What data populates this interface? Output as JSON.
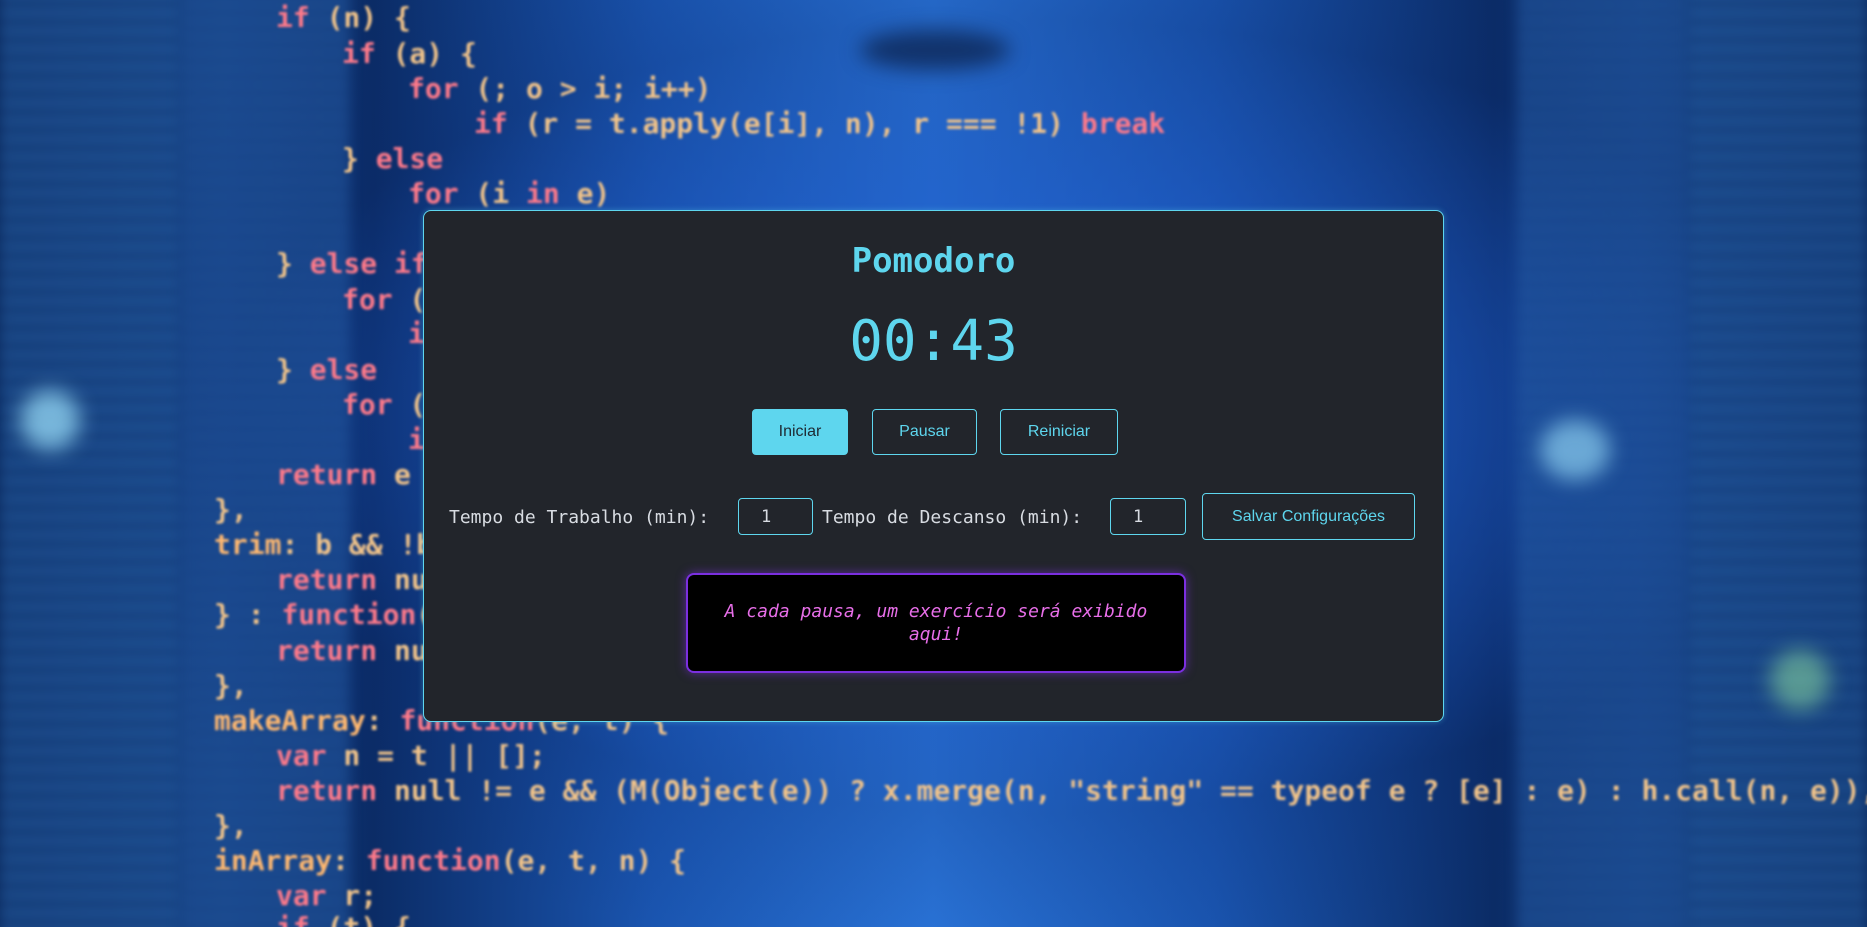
{
  "app": {
    "title": "Pomodoro",
    "timer": "00:43"
  },
  "controls": {
    "start_label": "Iniciar",
    "pause_label": "Pausar",
    "reset_label": "Reiniciar"
  },
  "settings": {
    "work_label": "Tempo de Trabalho (min):",
    "work_value": "1",
    "rest_label": "Tempo de Descanso (min):",
    "rest_value": "1",
    "save_label": "Salvar Configurações"
  },
  "exercise": {
    "message": "A cada pausa, um exercício será exibido aqui!"
  },
  "colors": {
    "accent": "#5ed6ee",
    "panel_bg": "#22252b",
    "exercise_border": "#7b2fe0",
    "exercise_text": "#e76ee8"
  }
}
